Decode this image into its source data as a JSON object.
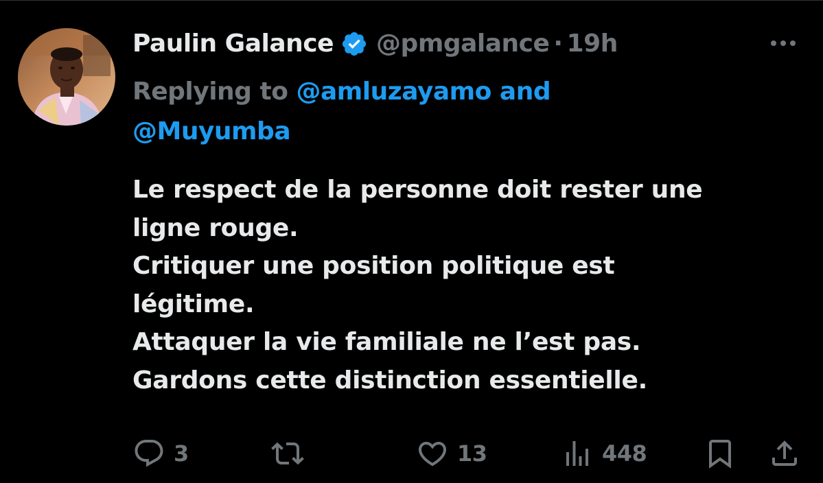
{
  "tweet": {
    "author": {
      "name": "Paulin Galance",
      "handle": "@pmgalance",
      "verified": true
    },
    "separator": "·",
    "time": "19h",
    "reply_to": {
      "prefix": "Replying to ",
      "mention_1": "@amluzayamo",
      "conjunction": " and",
      "mention_2": "@Muyumba"
    },
    "text_lines": [
      "Le respect de la personne doit rester une",
      "ligne rouge.",
      "Critiquer une position politique est",
      "légitime.",
      "Attaquer la vie familiale ne l’est pas.",
      "Gardons cette distinction essentielle."
    ],
    "stats": {
      "replies": "3",
      "retweets": "",
      "likes": "13",
      "views": "448"
    }
  },
  "icons": {
    "verified": "verified-badge-icon",
    "more": "more-horizontal-icon",
    "reply": "reply-bubble-icon",
    "retweet": "retweet-icon",
    "like": "heart-icon",
    "views": "bar-chart-icon",
    "bookmark": "bookmark-icon",
    "share": "share-icon"
  },
  "colors": {
    "background": "#000000",
    "text": "#e7e9ea",
    "secondary": "#71767b",
    "accent": "#1d9bf0"
  }
}
